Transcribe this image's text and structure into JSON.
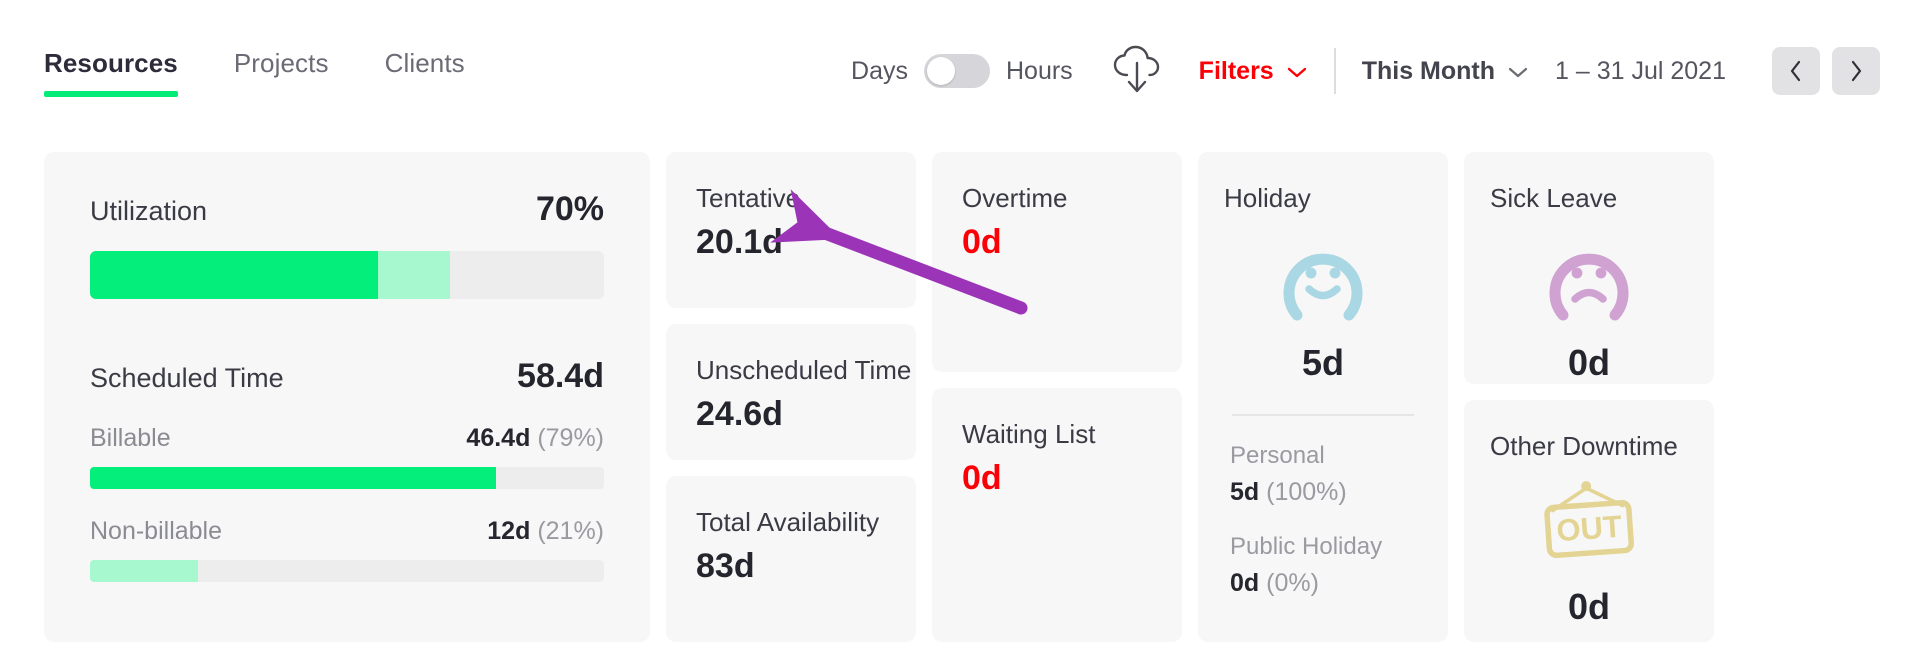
{
  "tabs": [
    {
      "label": "Resources",
      "active": true
    },
    {
      "label": "Projects",
      "active": false
    },
    {
      "label": "Clients",
      "active": false
    }
  ],
  "toolbar": {
    "unit_left": "Days",
    "unit_right": "Hours",
    "unit_selected": "Days",
    "download_icon": "cloud-download-icon",
    "filters_label": "Filters",
    "filters_chevron": "chevron-down-icon",
    "range_preset": "This Month",
    "range_preset_chevron": "chevron-down-icon",
    "date_range": "1 – 31 Jul 2021",
    "prev_icon": "chevron-left-icon",
    "next_icon": "chevron-right-icon",
    "accent_red": "#fb0007",
    "accent_green": "#03ec77"
  },
  "utilization": {
    "title": "Utilization",
    "value": "70%",
    "bar": {
      "strong_pct": 56,
      "soft_pct": 14,
      "strong_color": "#03ee7a",
      "soft_color": "#a8f8cf",
      "track_color": "#ededee"
    }
  },
  "scheduled": {
    "title": "Scheduled Time",
    "value": "58.4d",
    "rows": [
      {
        "label": "Billable",
        "value": "46.4d",
        "pct_text": "(79%)",
        "pct": 79,
        "color": "#03ee7a"
      },
      {
        "label": "Non-billable",
        "value": "12d",
        "pct_text": "(21%)",
        "pct": 21,
        "color": "#a8f8cf"
      }
    ]
  },
  "stats": {
    "tentative": {
      "label": "Tentative",
      "value": "20.1d"
    },
    "unscheduled": {
      "label": "Unscheduled Time",
      "value": "24.6d"
    },
    "availability": {
      "label": "Total Availability",
      "value": "83d"
    },
    "overtime": {
      "label": "Overtime",
      "value": "0d",
      "color": "#fb0007"
    },
    "waiting": {
      "label": "Waiting List",
      "value": "0d",
      "color": "#fb0007"
    }
  },
  "holiday": {
    "label": "Holiday",
    "icon": "smiley-face-icon",
    "icon_color": "#a9d7e4",
    "value": "5d",
    "breakdown": [
      {
        "label": "Personal",
        "value": "5d",
        "pct_text": "(100%)"
      },
      {
        "label": "Public Holiday",
        "value": "0d",
        "pct_text": "(0%)"
      }
    ]
  },
  "sick_leave": {
    "label": "Sick Leave",
    "icon": "sad-face-icon",
    "icon_color": "#cfa2d2",
    "value": "0d"
  },
  "other_downtime": {
    "label": "Other Downtime",
    "icon": "out-sign-icon",
    "icon_color": "#e3d493",
    "icon_text": "OUT",
    "value": "0d"
  },
  "annotation": {
    "type": "arrow",
    "color": "#9c34b8",
    "points_to": "tentative-card"
  }
}
